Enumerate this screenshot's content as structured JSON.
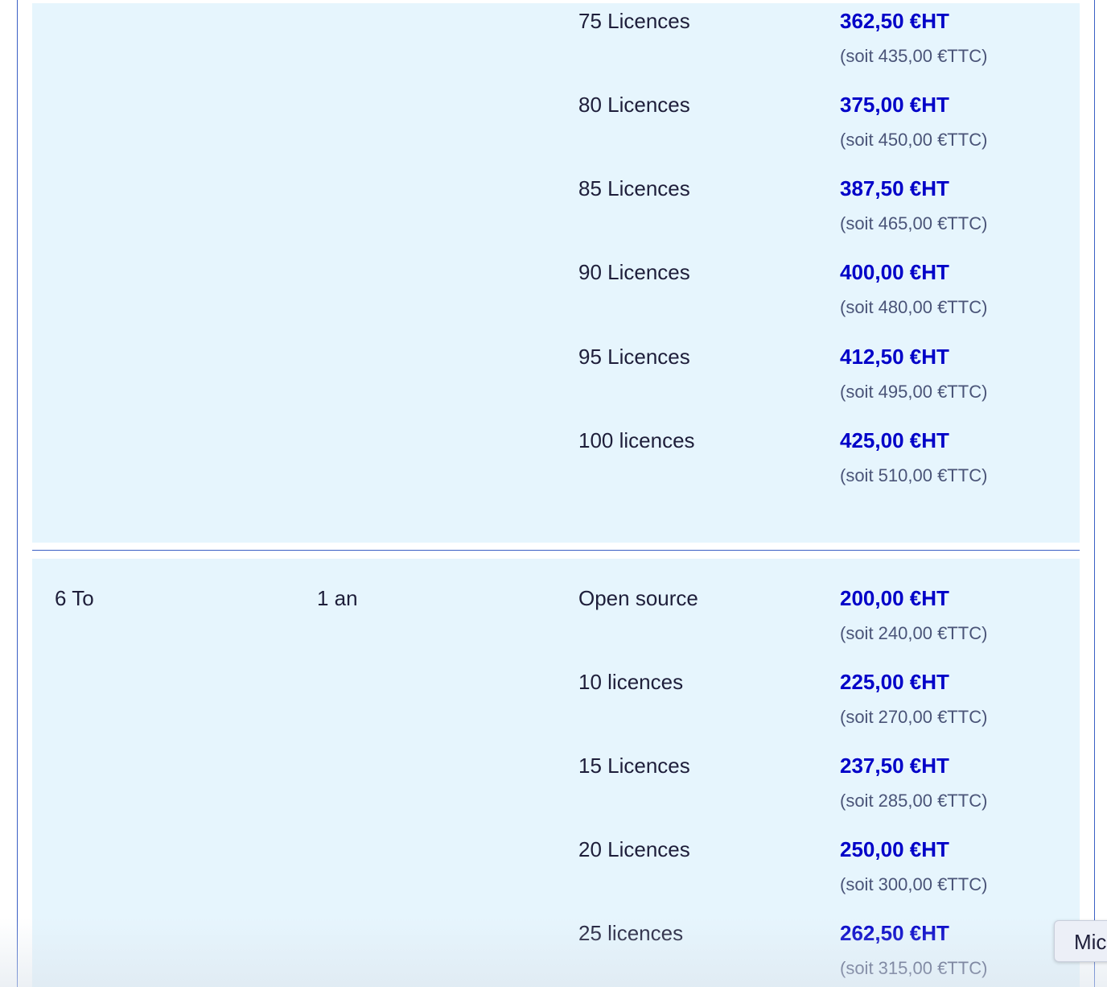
{
  "block_a": {
    "rows": [
      {
        "licence": "75 Licences",
        "ht": "362,50 €HT",
        "ttc": "(soit 435,00 €TTC)"
      },
      {
        "licence": "80 Licences",
        "ht": "375,00 €HT",
        "ttc": "(soit 450,00 €TTC)"
      },
      {
        "licence": "85 Licences",
        "ht": "387,50 €HT",
        "ttc": "(soit 465,00 €TTC)"
      },
      {
        "licence": "90 Licences",
        "ht": "400,00 €HT",
        "ttc": "(soit 480,00 €TTC)"
      },
      {
        "licence": "95 Licences",
        "ht": "412,50 €HT",
        "ttc": "(soit 495,00 €TTC)"
      },
      {
        "licence": "100 licences",
        "ht": "425,00 €HT",
        "ttc": "(soit 510,00 €TTC)"
      }
    ]
  },
  "block_b": {
    "size": "6 To",
    "duration": "1 an",
    "rows": [
      {
        "licence": "Open source",
        "ht": "200,00 €HT",
        "ttc": "(soit 240,00 €TTC)"
      },
      {
        "licence": "10 licences",
        "ht": "225,00 €HT",
        "ttc": "(soit 270,00 €TTC)"
      },
      {
        "licence": "15 Licences",
        "ht": "237,50 €HT",
        "ttc": "(soit 285,00 €TTC)"
      },
      {
        "licence": "20 Licences",
        "ht": "250,00 €HT",
        "ttc": "(soit 300,00 €TTC)"
      },
      {
        "licence": "25 licences",
        "ht": "262,50 €HT",
        "ttc": "(soit 315,00 €TTC)"
      }
    ]
  },
  "chat_button": {
    "label": "Mic"
  }
}
